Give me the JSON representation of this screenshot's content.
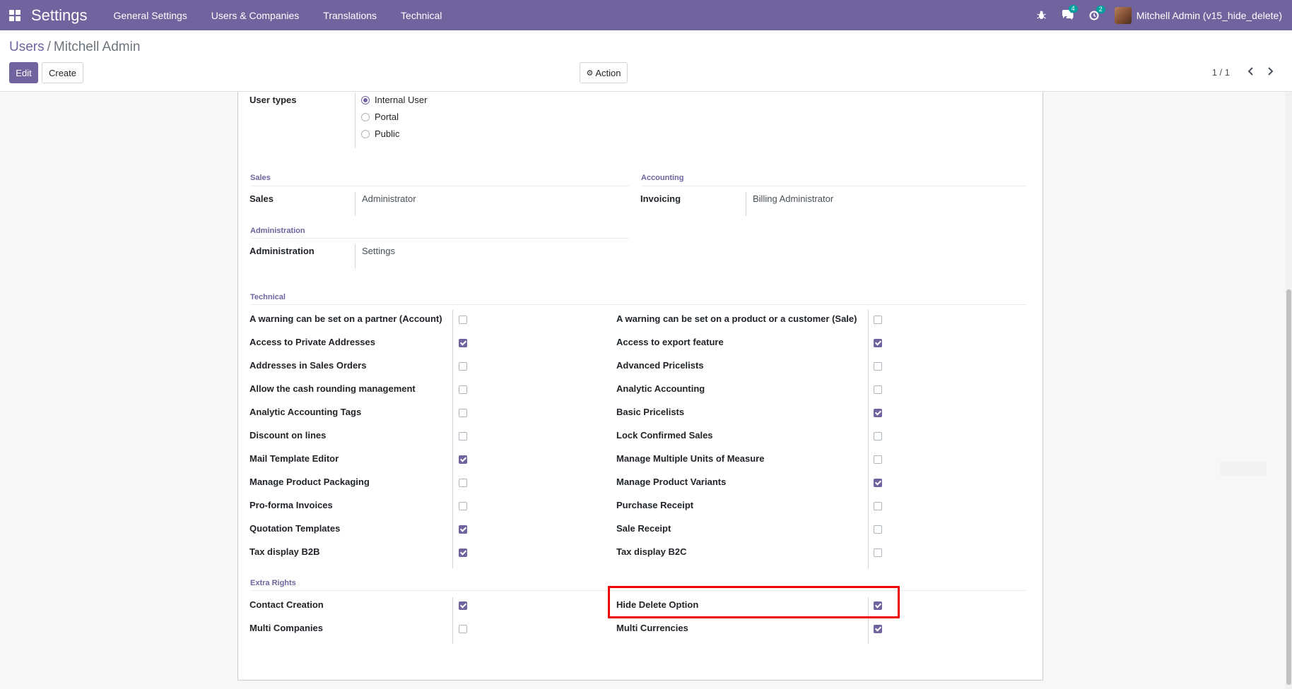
{
  "navbar": {
    "app_name": "Settings",
    "menu": [
      "General Settings",
      "Users & Companies",
      "Translations",
      "Technical"
    ],
    "messages_badge": "4",
    "activities_badge": "2",
    "user_name": "Mitchell Admin (v15_hide_delete)",
    "color": "#71639e"
  },
  "control_panel": {
    "breadcrumb_parent": "Users",
    "breadcrumb_sep": "/",
    "breadcrumb_current": "Mitchell Admin",
    "edit_label": "Edit",
    "create_label": "Create",
    "action_label": "Action",
    "pager": "1 / 1"
  },
  "form": {
    "user_types_label": "User types",
    "user_types": [
      {
        "label": "Internal User",
        "checked": true
      },
      {
        "label": "Portal",
        "checked": false
      },
      {
        "label": "Public",
        "checked": false
      }
    ],
    "sales_section": "Sales",
    "sales_label": "Sales",
    "sales_value": "Administrator",
    "accounting_section": "Accounting",
    "invoicing_label": "Invoicing",
    "invoicing_value": "Billing Administrator",
    "administration_section": "Administration",
    "administration_label": "Administration",
    "administration_value": "Settings",
    "technical_section": "Technical",
    "technical_left": [
      {
        "label": "A warning can be set on a partner (Account)",
        "checked": false
      },
      {
        "label": "Access to Private Addresses",
        "checked": true
      },
      {
        "label": "Addresses in Sales Orders",
        "checked": false
      },
      {
        "label": "Allow the cash rounding management",
        "checked": false
      },
      {
        "label": "Analytic Accounting Tags",
        "checked": false
      },
      {
        "label": "Discount on lines",
        "checked": false
      },
      {
        "label": "Mail Template Editor",
        "checked": true
      },
      {
        "label": "Manage Product Packaging",
        "checked": false
      },
      {
        "label": "Pro-forma Invoices",
        "checked": false
      },
      {
        "label": "Quotation Templates",
        "checked": true
      },
      {
        "label": "Tax display B2B",
        "checked": true
      }
    ],
    "technical_right": [
      {
        "label": "A warning can be set on a product or a customer (Sale)",
        "checked": false
      },
      {
        "label": "Access to export feature",
        "checked": true
      },
      {
        "label": "Advanced Pricelists",
        "checked": false
      },
      {
        "label": "Analytic Accounting",
        "checked": false
      },
      {
        "label": "Basic Pricelists",
        "checked": true
      },
      {
        "label": "Lock Confirmed Sales",
        "checked": false
      },
      {
        "label": "Manage Multiple Units of Measure",
        "checked": false
      },
      {
        "label": "Manage Product Variants",
        "checked": true
      },
      {
        "label": "Purchase Receipt",
        "checked": false
      },
      {
        "label": "Sale Receipt",
        "checked": false
      },
      {
        "label": "Tax display B2C",
        "checked": false
      }
    ],
    "extra_section": "Extra Rights",
    "extra_left": [
      {
        "label": "Contact Creation",
        "checked": true
      },
      {
        "label": "Multi Companies",
        "checked": false
      }
    ],
    "extra_right": [
      {
        "label": "Hide Delete Option",
        "checked": true
      },
      {
        "label": "Multi Currencies",
        "checked": true
      }
    ],
    "highlight_color": "#e00000"
  }
}
